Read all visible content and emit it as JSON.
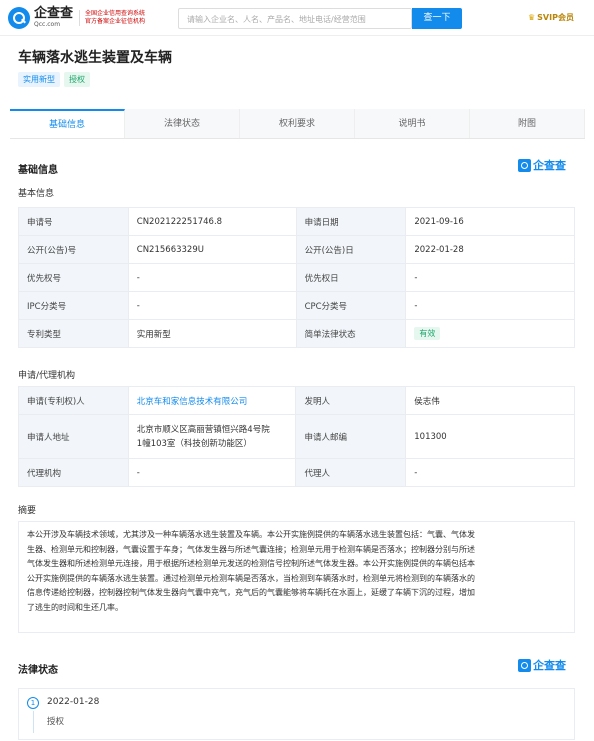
{
  "header": {
    "logo_cn": "企查查",
    "logo_en": "Qcc.com",
    "logo_badge_line1": "全国企业信用查询系统",
    "logo_badge_line2": "官方备案企业征信机构",
    "search_placeholder": "请输入企业名、人名、产品名、地址电话/经营范围",
    "search_button": "查一下",
    "svip_label": "SVIP会员"
  },
  "title": "车辆落水逃生装置及车辆",
  "tags": [
    "实用新型",
    "授权"
  ],
  "tabs": [
    "基础信息",
    "法律状态",
    "权利要求",
    "说明书",
    "附图"
  ],
  "basic": {
    "section_title": "基础信息",
    "brand": "企查查",
    "subsection": "基本信息",
    "rows": [
      {
        "k1": "申请号",
        "v1": "CN202122251746.8",
        "k2": "申请日期",
        "v2": "2021-09-16"
      },
      {
        "k1": "公开(公告)号",
        "v1": "CN215663329U",
        "k2": "公开(公告)日",
        "v2": "2022-01-28"
      },
      {
        "k1": "优先权号",
        "v1": "-",
        "k2": "优先权日",
        "v2": "-"
      },
      {
        "k1": "IPC分类号",
        "v1": "-",
        "k2": "CPC分类号",
        "v2": "-"
      },
      {
        "k1": "专利类型",
        "v1": "实用新型",
        "k2": "简单法律状态",
        "v2": "有效"
      }
    ]
  },
  "agency": {
    "subsection": "申请/代理机构",
    "rows": [
      {
        "k1": "申请(专利权)人",
        "v1": "北京车和家信息技术有限公司",
        "k2": "发明人",
        "v2": "侯志伟"
      },
      {
        "k1": "申请人地址",
        "v1_line1": "北京市顺义区高丽营镇恒兴路4号院",
        "v1_line2": "1幢103室（科技创新功能区）",
        "k2": "申请人邮编",
        "v2": "101300"
      },
      {
        "k1": "代理机构",
        "v1": "-",
        "k2": "代理人",
        "v2": "-"
      }
    ]
  },
  "abstract": {
    "title": "摘要",
    "lines": [
      "本公开涉及车辆技术领域，尤其涉及一种车辆落水逃生装置及车辆。本公开实施例提供的车辆落水逃生装置包括：气囊、气体发",
      "生器、检测单元和控制器，气囊设置于车身；气体发生器与所述气囊连接；检测单元用于检测车辆是否落水；控制器分别与所述",
      "气体发生器和所述检测单元连接，用于根据所述检测单元发送的检测信号控制所述气体发生器。本公开实施例提供的车辆包括本",
      "公开实施例提供的车辆落水逃生装置。通过检测单元检测车辆是否落水，当检测到车辆落水时，检测单元将检测到的车辆落水的",
      "信息传递给控制器，控制器控制气体发生器向气囊中充气，充气后的气囊能够将车辆托在水面上，延缓了车辆下沉的过程，增加",
      "了逃生的时间和生还几率。"
    ]
  },
  "legal": {
    "section_title": "法律状态",
    "brand": "企查查",
    "items": [
      {
        "num": "1",
        "date": "2022-01-28",
        "text": "授权"
      }
    ]
  }
}
